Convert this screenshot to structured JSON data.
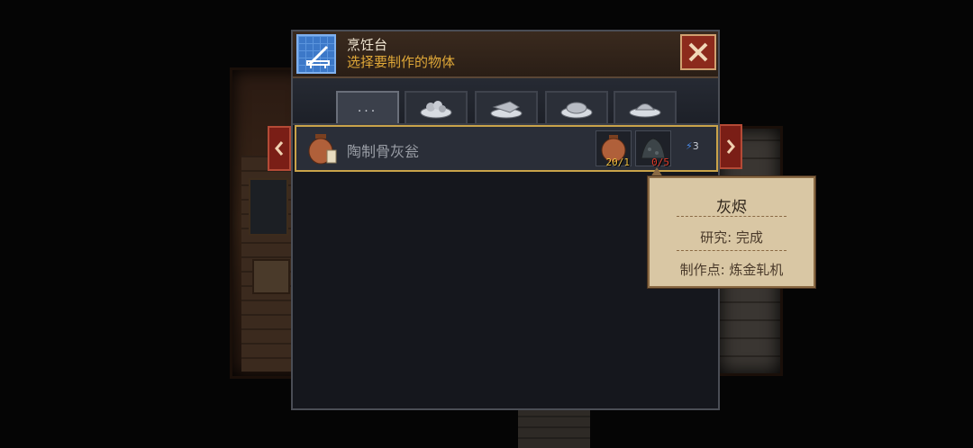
{
  "header": {
    "title": "烹饪台",
    "subtitle": "选择要制作的物体",
    "station_icon": "blueprint-workbench-icon",
    "close_icon": "close-x-icon"
  },
  "tabs": [
    {
      "label": "...",
      "icon": "more-dots-icon",
      "active": true
    },
    {
      "icon": "food-plate-icon",
      "active": false
    },
    {
      "icon": "fish-plate-icon",
      "active": false
    },
    {
      "icon": "meat-plate-icon",
      "active": false
    },
    {
      "icon": "dish-plate-icon",
      "active": false
    }
  ],
  "recipe": {
    "name": "陶制骨灰瓮",
    "icon": "clay-urn-icon",
    "ingredients": [
      {
        "icon": "clay-pot-icon",
        "count": "20/1",
        "color": "#f0c040"
      },
      {
        "icon": "ash-pile-icon",
        "count": "0/5",
        "color": "#e03a2a"
      }
    ],
    "energy_icon": "lightning-icon",
    "energy": "3"
  },
  "tooltip": {
    "title": "灰烬",
    "research": "研究:  完成",
    "craft_at": "制作点:  炼金轧机"
  },
  "colors": {
    "accent_gold": "#c9a34a",
    "close_red": "#8c2a1c",
    "subtitle_orange": "#e0a838"
  }
}
